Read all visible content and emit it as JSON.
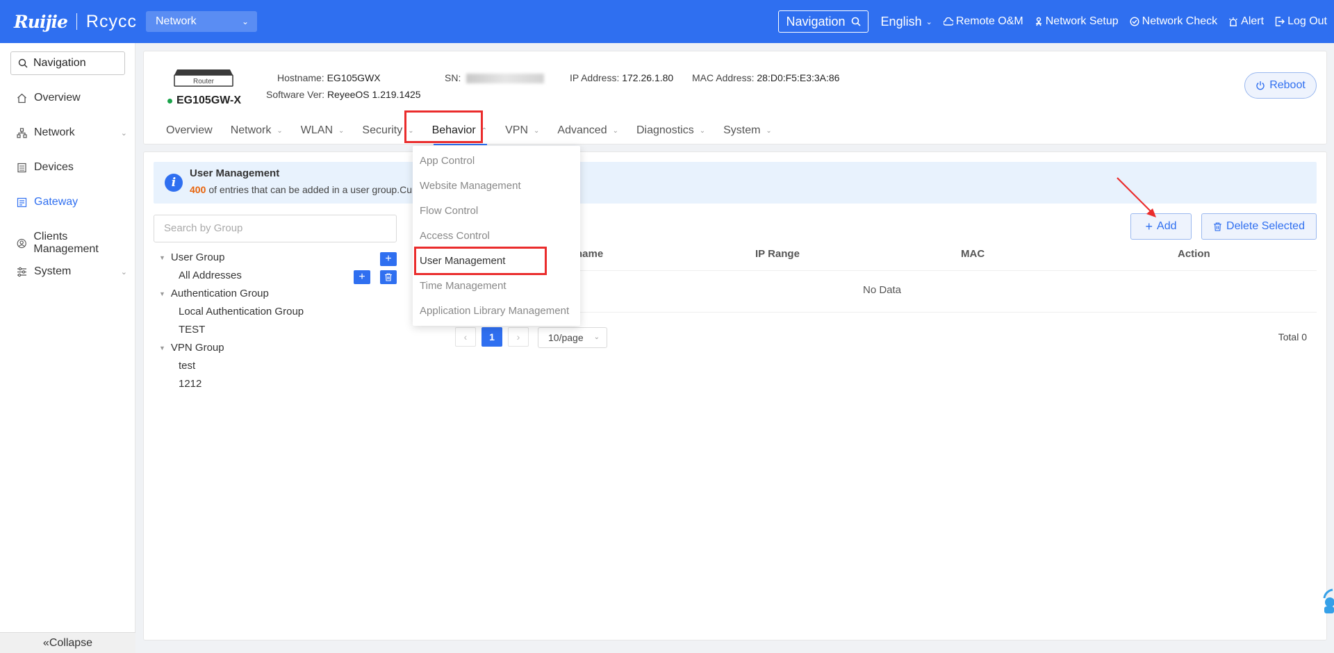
{
  "topbar": {
    "brand": "Ruijie",
    "product": "Rcycc",
    "network_select": "Network",
    "navigation_label": "Navigation",
    "language": "English",
    "items": [
      "Remote O&M",
      "Network Setup",
      "Network Check",
      "Alert",
      "Log Out"
    ]
  },
  "sidebar": {
    "search_label": "Navigation",
    "items": [
      {
        "label": "Overview",
        "icon": "home-icon"
      },
      {
        "label": "Network",
        "icon": "topology-icon"
      },
      {
        "label": "Devices",
        "icon": "device-icon"
      },
      {
        "label": "Gateway",
        "icon": "gateway-icon"
      },
      {
        "label": "Clients Management",
        "icon": "user-icon"
      },
      {
        "label": "System",
        "icon": "sliders-icon"
      }
    ],
    "collapse_label": "Collapse",
    "active_color": "#2f6ff0"
  },
  "device": {
    "router_label": "Router",
    "name": "EG105GW-X",
    "hostname_label": "Hostname:",
    "hostname": "EG105GWX",
    "software_label": "Software Ver:",
    "software": "ReyeeOS 1.219.1425",
    "sn_label": "SN:",
    "ip_label": "IP Address:",
    "ip": "172.26.1.80",
    "mac_label": "MAC Address:",
    "mac": "28:D0:F5:E3:3A:86",
    "reboot_label": "Reboot"
  },
  "tabs": [
    "Overview",
    "Network",
    "WLAN",
    "Security",
    "Behavior",
    "VPN",
    "Advanced",
    "Diagnostics",
    "System"
  ],
  "behavior_menu": [
    "App Control",
    "Website Management",
    "Flow Control",
    "Access Control",
    "User Management",
    "Time Management",
    "Application Library Management"
  ],
  "main": {
    "alert_title": "User Management",
    "alert_count": "400",
    "alert_text": "of entries that can be added in a user group.Cu",
    "group_search_placeholder": "Search by Group",
    "tree": {
      "user_group": "User Group",
      "all_addresses": "All Addresses",
      "auth_group": "Authentication Group",
      "local_auth_group": "Local Authentication Group",
      "test_upper": "TEST",
      "vpn_group": "VPN Group",
      "test_lower": "test",
      "num_1212": "1212"
    },
    "add_label": "Add",
    "delete_label": "Delete Selected",
    "columns": [
      "name",
      "IP Range",
      "MAC",
      "Action"
    ],
    "no_data": "No Data",
    "page_current": "1",
    "page_size": "10/page",
    "total": "Total 0"
  },
  "colors": {
    "primary": "#2f6ff0",
    "highlight": "#ea2c2c",
    "warning_number": "#e8640c",
    "online": "#1aa34a"
  }
}
